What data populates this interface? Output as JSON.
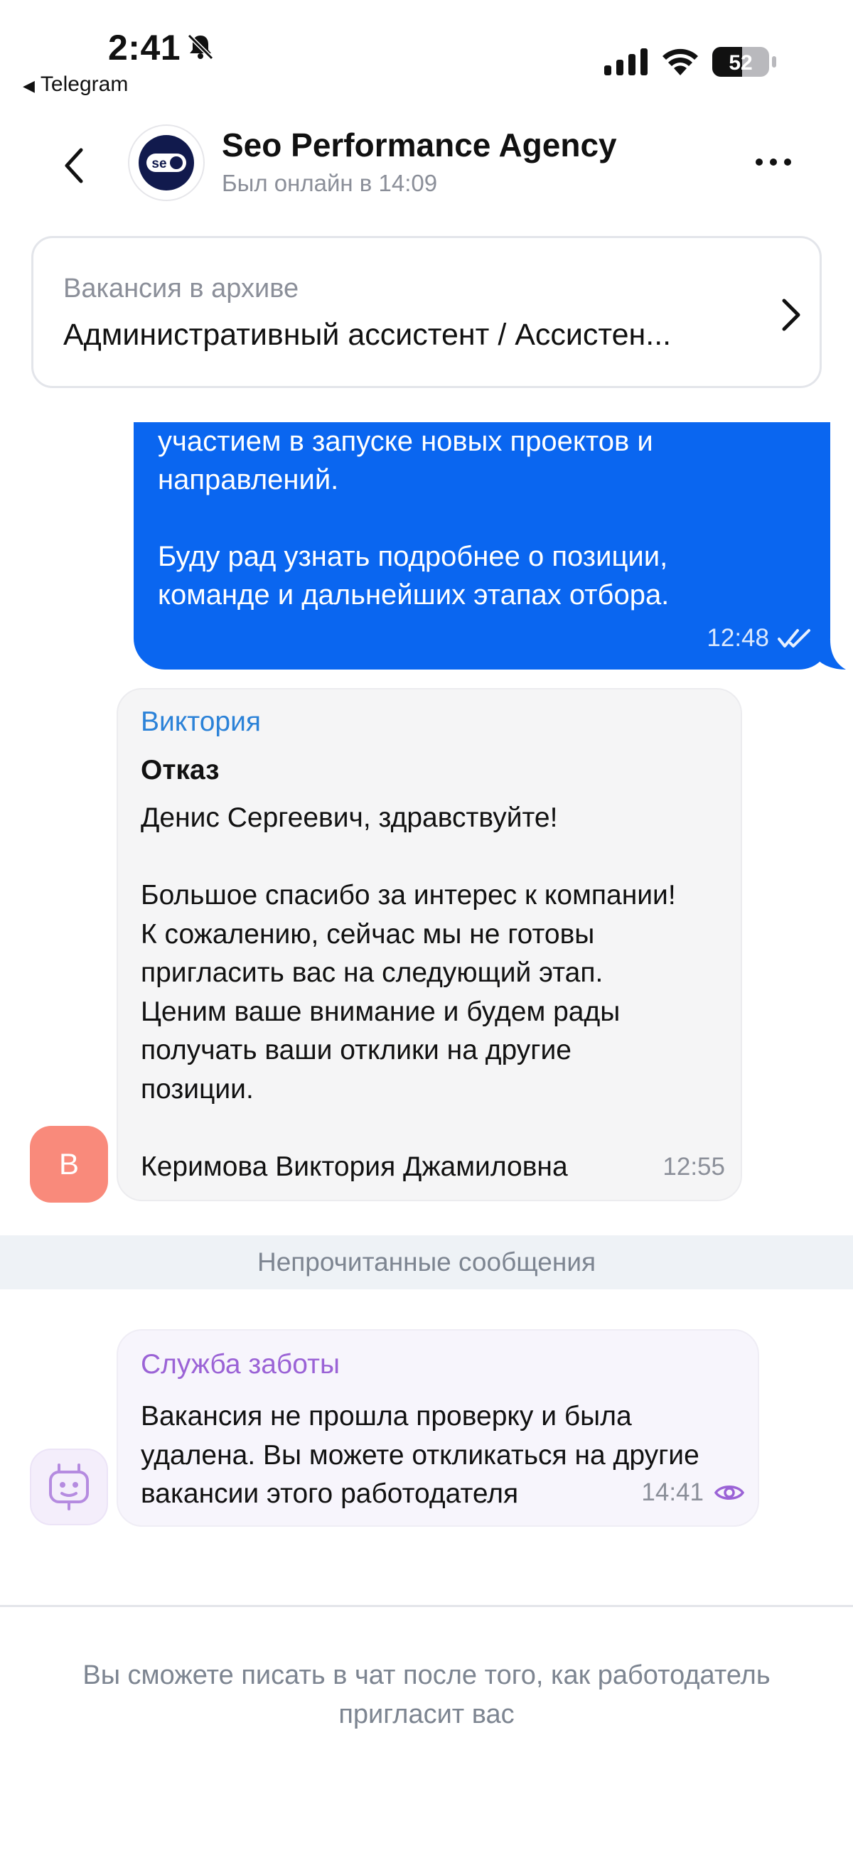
{
  "status_bar": {
    "time": "2:41",
    "back_app": "Telegram",
    "battery": "52"
  },
  "header": {
    "title": "Seo Performance Agency",
    "subtitle": "Был онлайн в 14:09",
    "logo_text": "se"
  },
  "vacancy": {
    "label": "Вакансия в архиве",
    "title": "Административный ассистент / Ассистен..."
  },
  "messages": {
    "outgoing": {
      "text": "участием в запуске новых проектов и\nнаправлений.\n\nБуду рад узнать подробнее о позиции,\nкоманде и дальнейших этапах отбора.",
      "time": "12:48"
    },
    "incoming": {
      "sender": "Виктория",
      "subject": "Отказ",
      "body": "Денис Сергеевич, здравствуйте!\n\nБольшое спасибо за интерес к компании!\nК сожалению, сейчас мы не готовы\nпригласить вас на следующий этап.\nЦеним ваше внимание и будем рады\nполучать ваши отклики на другие\nпозиции.\n\nКеримова Виктория Джамиловна",
      "time": "12:55",
      "avatar_letter": "В"
    },
    "unread_divider": "Непрочитанные сообщения",
    "care": {
      "sender": "Служба заботы",
      "body": "Вакансия не прошла проверку и была\nудалена. Вы можете откликаться на другие\nвакансии этого работодателя",
      "time": "14:41"
    }
  },
  "footer": {
    "note": "Вы сможете писать в чат после того, как работодатель пригласит вас"
  },
  "colors": {
    "outgoing_bubble": "#0a66f0",
    "sender_blue": "#2b82d8",
    "care_purple": "#9b63d6",
    "avatar_salmon": "#f98a7b"
  }
}
